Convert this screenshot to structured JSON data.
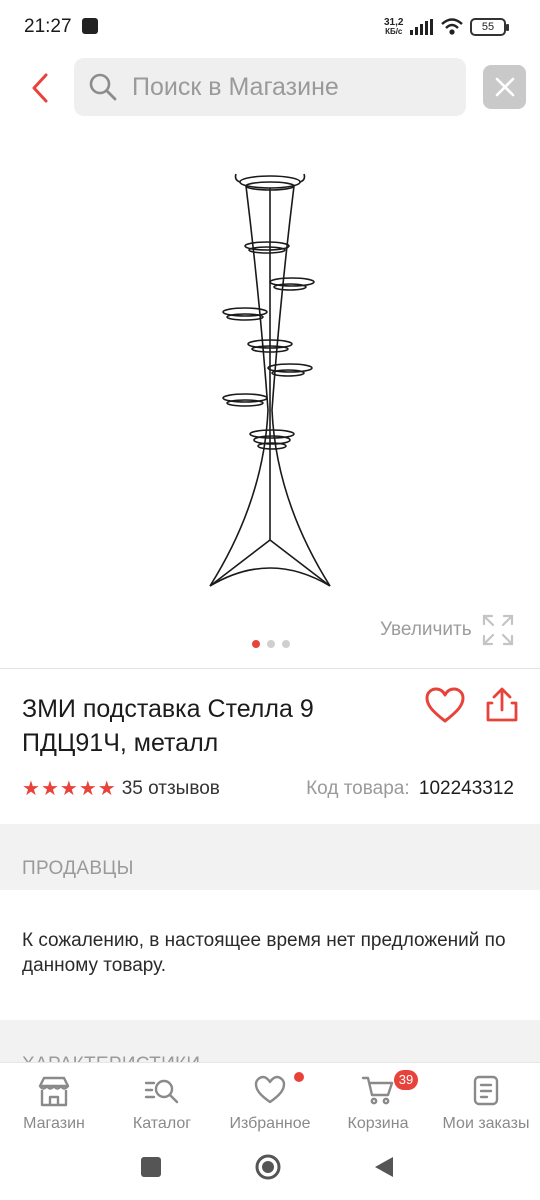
{
  "status_bar": {
    "time": "21:27",
    "net_speed_value": "31,2",
    "net_speed_unit": "КБ/с",
    "battery": "55"
  },
  "top_bar": {
    "search_placeholder": "Поиск в Магазине"
  },
  "gallery": {
    "zoom_label": "Увеличить",
    "image_count": 3,
    "active_index": 0
  },
  "product": {
    "title": "ЗМИ подставка Стелла 9 ПДЦ91Ч, металл",
    "rating_stars": 5,
    "reviews": "35 отзывов",
    "code_label": "Код товара:",
    "code_value": "102243312"
  },
  "sellers": {
    "heading": "ПРОДАВЦЫ",
    "message": "К сожалению, в настоящее время нет предложений по данному товару."
  },
  "characteristics": {
    "heading": "ХАРАКТЕРИСТИКИ"
  },
  "bottom_nav": {
    "items": [
      {
        "label": "Магазин",
        "icon": "store-icon"
      },
      {
        "label": "Каталог",
        "icon": "catalog-search-icon"
      },
      {
        "label": "Избранное",
        "icon": "heart-icon"
      },
      {
        "label": "Корзина",
        "icon": "cart-icon"
      },
      {
        "label": "Мои заказы",
        "icon": "orders-icon"
      }
    ],
    "cart_badge": "39"
  },
  "colors": {
    "accent": "#e8433a",
    "muted_text": "#9a9a9a",
    "section_bg": "#f2f2f2"
  }
}
